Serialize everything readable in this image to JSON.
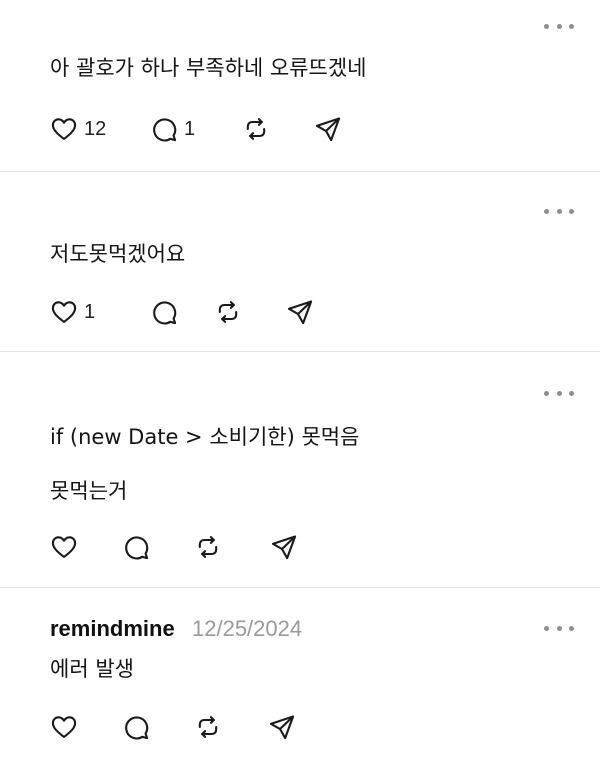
{
  "posts": [
    {
      "lines": [
        "아 괄호가 하나 부족하네 오류뜨겠네"
      ],
      "likes": "12",
      "replies": "1"
    },
    {
      "lines": [
        "저도못먹겠어요"
      ],
      "likes": "1",
      "replies": ""
    },
    {
      "lines": [
        "if (new Date > 소비기한) 못먹음",
        "못먹는거"
      ],
      "likes": "",
      "replies": ""
    },
    {
      "username": "remindmine",
      "timestamp": "12/25/2024",
      "lines": [
        "에러 발생"
      ],
      "likes": "",
      "replies": ""
    }
  ],
  "icons": {
    "like": "heart-icon",
    "reply": "speech-bubble-icon",
    "repost": "repost-icon",
    "share": "paper-plane-icon",
    "more": "more-dots-icon"
  },
  "colors": {
    "text": "#141414",
    "muted": "#9b9b9b",
    "divider": "#e3e3e3",
    "icon": "#1a1a1a"
  }
}
